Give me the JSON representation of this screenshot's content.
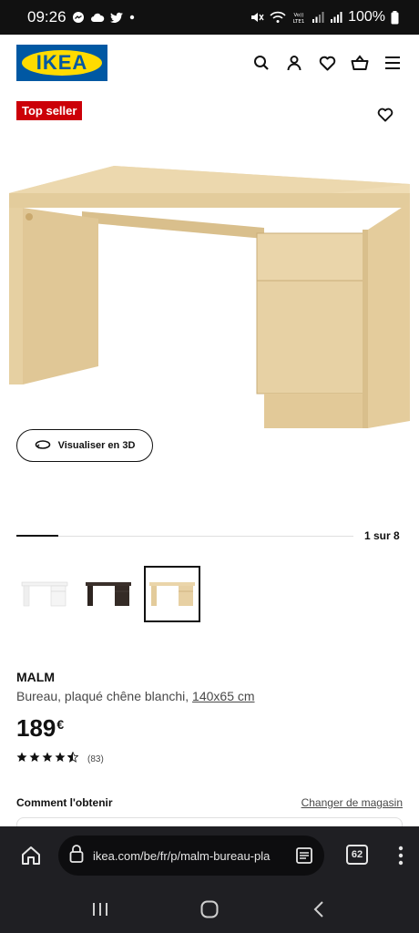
{
  "status_bar": {
    "time": "09:26",
    "battery": "100%"
  },
  "header": {
    "logo_text": "IKEA",
    "icons": [
      "search-icon",
      "user-icon",
      "heart-icon",
      "basket-icon",
      "menu-icon"
    ]
  },
  "product": {
    "badge": "Top seller",
    "view_3d_label": "Visualiser en 3D",
    "carousel_counter": "1 sur 8",
    "carousel_progress": 0.125,
    "thumbnails": [
      {
        "variant": "white",
        "selected": false
      },
      {
        "variant": "black-brown",
        "selected": false
      },
      {
        "variant": "white-stained-oak",
        "selected": true
      }
    ],
    "name": "MALM",
    "description": "Bureau, plaqué chêne blanchi,",
    "dimensions": "140x65 cm",
    "price": "189",
    "currency": "€",
    "rating_value": 4.5,
    "rating_count": "(83)"
  },
  "availability": {
    "label": "Comment l'obtenir",
    "change_store": "Changer de magasin"
  },
  "browser": {
    "url": "ikea.com/be/fr/p/malm-bureau-pla",
    "tabs_count": "62"
  },
  "colors": {
    "ikea_blue": "#0058a3",
    "ikea_yellow": "#ffdb00",
    "badge_red": "#cc0008",
    "wood": "#e8d3a6"
  }
}
